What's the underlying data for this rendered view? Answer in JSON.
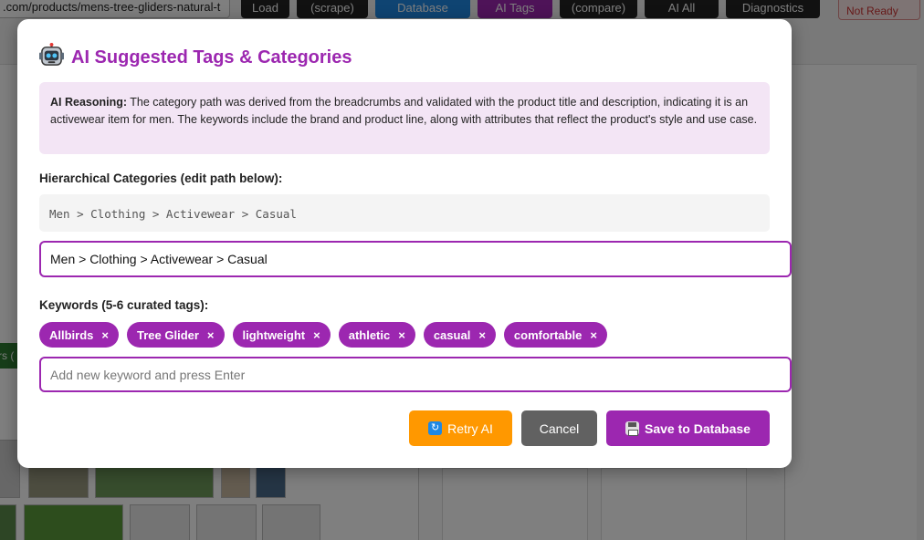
{
  "background": {
    "url_text": ".com/products/mens-tree-gliders-natural-t",
    "toolbar": [
      {
        "label": "Load",
        "color": "#222222"
      },
      {
        "label": "(scrape)",
        "color": "#222222"
      },
      {
        "label": "Database",
        "color": "#1e88e5"
      },
      {
        "label": "AI Tags",
        "color": "#9c27b0"
      },
      {
        "label": "(compare)",
        "color": "#222222"
      },
      {
        "label": "AI All",
        "color": "#222222"
      },
      {
        "label": "Diagnostics",
        "color": "#222222"
      }
    ],
    "status": "Not Ready"
  },
  "modal": {
    "title": "AI Suggested Tags & Categories",
    "title_icon": "robot-icon",
    "reasoning_label": "AI Reasoning:",
    "reasoning_text": " The category path was derived from the breadcrumbs and validated with the product title and description, indicating it is an activewear item for men. The keywords include the brand and product line, along with attributes that reflect the product's style and use case.",
    "categories_label": "Hierarchical Categories (edit path below):",
    "category_path_display": "Men > Clothing > Activewear > Casual",
    "category_path_value": "Men > Clothing > Activewear > Casual",
    "keywords_label": "Keywords (5-6 curated tags):",
    "keywords": [
      {
        "label": "Allbirds",
        "remove": "×"
      },
      {
        "label": "Tree Glider",
        "remove": "×"
      },
      {
        "label": "lightweight",
        "remove": "×"
      },
      {
        "label": "athletic",
        "remove": "×"
      },
      {
        "label": "casual",
        "remove": "×"
      },
      {
        "label": "comfortable",
        "remove": "×"
      }
    ],
    "keyword_placeholder": "Add new keyword and press Enter",
    "buttons": {
      "retry": "Retry AI",
      "cancel": "Cancel",
      "save": "Save to Database"
    },
    "colors": {
      "accent": "#9c27b0",
      "retry": "#ff9800",
      "cancel": "#616161",
      "reasoning_bg": "#f3e5f5"
    }
  }
}
